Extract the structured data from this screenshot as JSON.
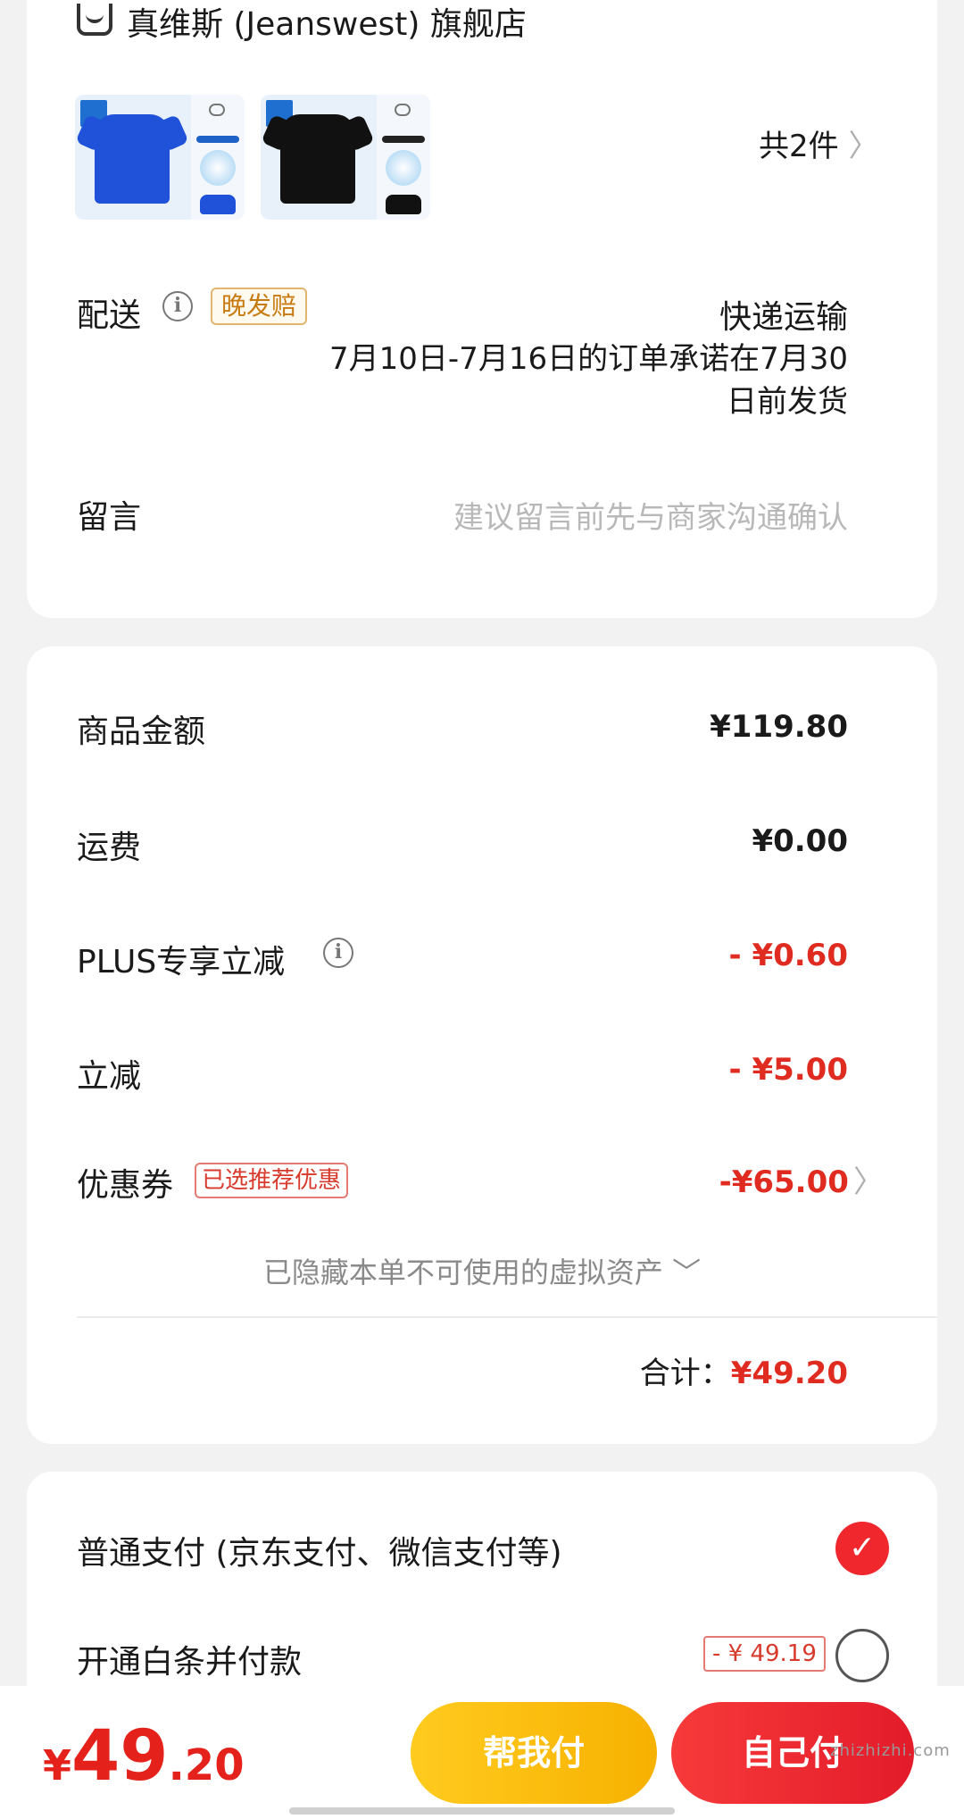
{
  "store": {
    "name": "真维斯 (Jeanswest) 旗舰店",
    "item_count": "共2件",
    "chevron": "〉",
    "products": [
      {
        "color": "#1f52d8",
        "variant": "宝蓝"
      },
      {
        "color": "#111111",
        "variant": "黑色"
      }
    ]
  },
  "shipping": {
    "label": "配送",
    "info_icon": "i",
    "late_badge": "晚发赔",
    "method": "快递运输",
    "promise": "7月10日-7月16日的订单承诺在7月30日前发货"
  },
  "message": {
    "label": "留言",
    "placeholder": "建议留言前先与商家沟通确认"
  },
  "price": {
    "rows": [
      {
        "label": "商品金额",
        "value": "¥119.80"
      },
      {
        "label": "运费",
        "value": "¥0.00"
      },
      {
        "label": "PLUS专享立减",
        "value": "- ¥0.60"
      },
      {
        "label": "立减",
        "value": "- ¥5.00"
      },
      {
        "label": "优惠券",
        "value": "-¥65.00"
      }
    ],
    "coupon_badge": "已选推荐优惠",
    "hidden_assets": "已隐藏本单不可使用的虚拟资产 ﹀",
    "total_label": "合计：",
    "total_value": "¥49.20"
  },
  "payment": {
    "normal": "普通支付 (京东支付、微信支付等)",
    "normal_check": "✓",
    "baitiao": "开通白条并付款",
    "baitiao_badge": "- ¥ 49.19"
  },
  "bottom": {
    "currency": "¥",
    "amount_int": "49",
    "amount_dec": ".20",
    "help_pay": "帮我付",
    "self_pay": "自己付",
    "watermark": "zhizhizhi.com"
  },
  "colors": {
    "accent_red": "#e02c20",
    "help_yellow": "#ffcb1f",
    "self_red": "#f0282e"
  }
}
